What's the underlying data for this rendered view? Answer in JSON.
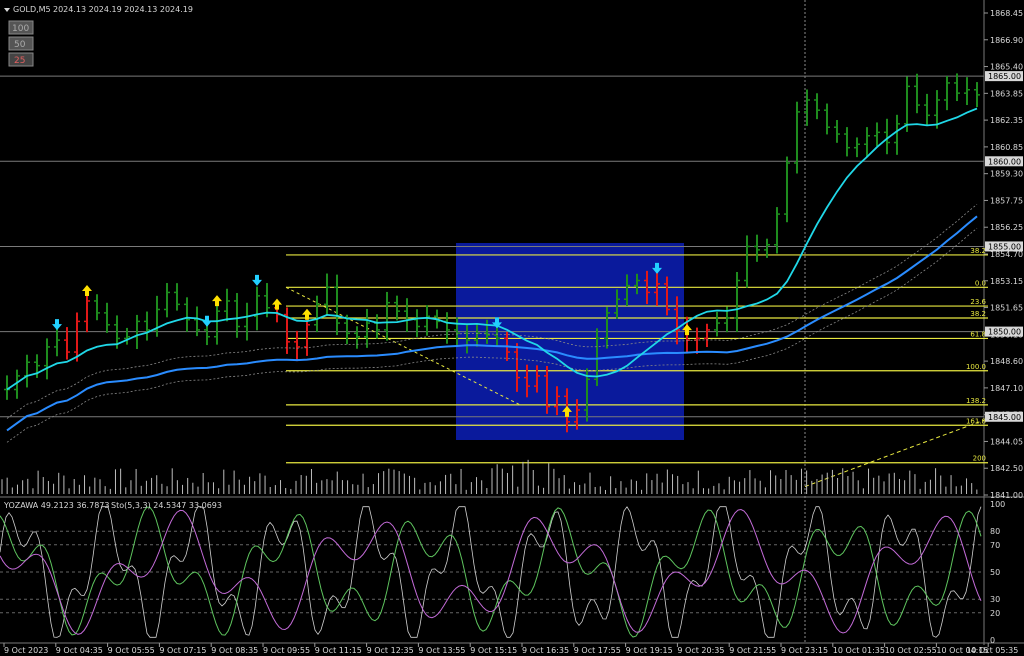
{
  "header": {
    "symbol": "GOLD,M5",
    "ohlc": "2024.13 2024.19 2024.13 2024.19",
    "zoom_buttons": [
      "100",
      "50",
      "25"
    ]
  },
  "indicator_header": {
    "yozawa": "YOZAWA 49.2123 36.7873",
    "stoch": "Sto(5,3,3) 24.5347 33.0693"
  },
  "colors": {
    "background": "#000000",
    "bull_bar": "#1e8c1e",
    "bear_bar": "#e01818",
    "ma_fast": "#20d8e8",
    "ma_slow": "#2a8cff",
    "fib_line": "#e8e840",
    "zone_fill": "#0a1a9c",
    "buy_arrow": "#ffe000",
    "sell_arrow": "#22d0ff"
  },
  "price_axis": {
    "ticks": [
      "1868.45",
      "1866.90",
      "1865.40",
      "1863.85",
      "1862.35",
      "1860.85",
      "1859.30",
      "1857.75",
      "1856.25",
      "1854.70",
      "1853.15",
      "1851.65",
      "1850.10",
      "1848.60",
      "1847.10",
      "1845.55",
      "1844.05",
      "1842.50",
      "1841.00"
    ],
    "boxed": [
      "1865.00",
      "1860.00",
      "1855.00",
      "1850.00",
      "1845.00"
    ]
  },
  "osc_axis": {
    "ticks": [
      "100",
      "80",
      "70",
      "50",
      "30",
      "20",
      "0"
    ]
  },
  "time_axis": {
    "labels": [
      "9 Oct 2023",
      "9 Oct 04:35",
      "9 Oct 05:55",
      "9 Oct 07:15",
      "9 Oct 08:35",
      "9 Oct 09:55",
      "9 Oct 11:15",
      "9 Oct 12:35",
      "9 Oct 13:55",
      "9 Oct 15:15",
      "9 Oct 16:35",
      "9 Oct 17:55",
      "9 Oct 19:15",
      "9 Oct 20:35",
      "9 Oct 21:55",
      "9 Oct 23:15",
      "10 Oct 01:35",
      "10 Oct 02:55",
      "10 Oct 04:15",
      "10 Oct 05:35"
    ]
  },
  "chart_data": {
    "type": "bar",
    "symbol": "GOLD",
    "timeframe": "M5",
    "ylim": [
      1840.7,
      1869.0
    ],
    "fibonacci": {
      "levels": [
        "38.2",
        "0.0",
        "23.6",
        "38.2",
        "61.8",
        "100.0",
        "138.2",
        "161.8",
        "200"
      ],
      "prices": [
        1854.5,
        1852.6,
        1851.5,
        1850.8,
        1849.6,
        1847.7,
        1845.7,
        1844.5,
        1842.3
      ]
    },
    "zone": {
      "price_high": 1855.2,
      "price_low": 1844.3
    },
    "highlighted_prices": [
      1865.0,
      1860.0,
      1855.0,
      1850.0,
      1845.0
    ],
    "oscillator_levels": [
      100,
      80,
      70,
      50,
      30,
      20,
      0
    ],
    "price_series": [
      1846.6,
      1847.4,
      1848.2,
      1848.0,
      1849.1,
      1849.5,
      1848.8,
      1850.6,
      1851.8,
      1851.1,
      1850.4,
      1849.6,
      1849.7,
      1850.6,
      1850.1,
      1851.3,
      1852.3,
      1851.6,
      1850.7,
      1850.1,
      1849.7,
      1851.2,
      1851.8,
      1850.3,
      1850.9,
      1852.1,
      1851.4,
      1851.0,
      1849.4,
      1849.1,
      1850.4,
      1851.6,
      1852.6,
      1850.5,
      1849.9,
      1849.7,
      1850.5,
      1850.1,
      1851.7,
      1851.2,
      1850.7,
      1850.3,
      1850.9,
      1850.6,
      1850.1,
      1849.9,
      1849.5,
      1849.9,
      1849.8,
      1849.6,
      1848.8,
      1847.3,
      1846.8,
      1847.4,
      1845.6,
      1846.2,
      1844.7,
      1845.4,
      1847.2,
      1849.6,
      1851.1,
      1851.9,
      1852.7,
      1853.0,
      1852.3,
      1852.8,
      1851.3,
      1850.1,
      1849.5,
      1849.6,
      1850.1,
      1850.5,
      1850.8,
      1853.0,
      1855.0,
      1854.8,
      1855.1,
      1856.9,
      1859.9,
      1862.9,
      1863.6,
      1863.0,
      1862.0,
      1861.6,
      1860.8,
      1861.0,
      1861.5,
      1861.7,
      1861.1,
      1862.2,
      1864.4,
      1863.3,
      1862.7,
      1863.6,
      1864.6,
      1864.0,
      1864.2,
      1863.9
    ],
    "bear_segments": [
      [
        6,
        8
      ],
      [
        27,
        30
      ],
      [
        50,
        57
      ],
      [
        64,
        70
      ]
    ],
    "buy_arrow_index": [
      8,
      21,
      27,
      30,
      56,
      68
    ],
    "sell_arrow_index": [
      5,
      20,
      25,
      49,
      65
    ]
  }
}
